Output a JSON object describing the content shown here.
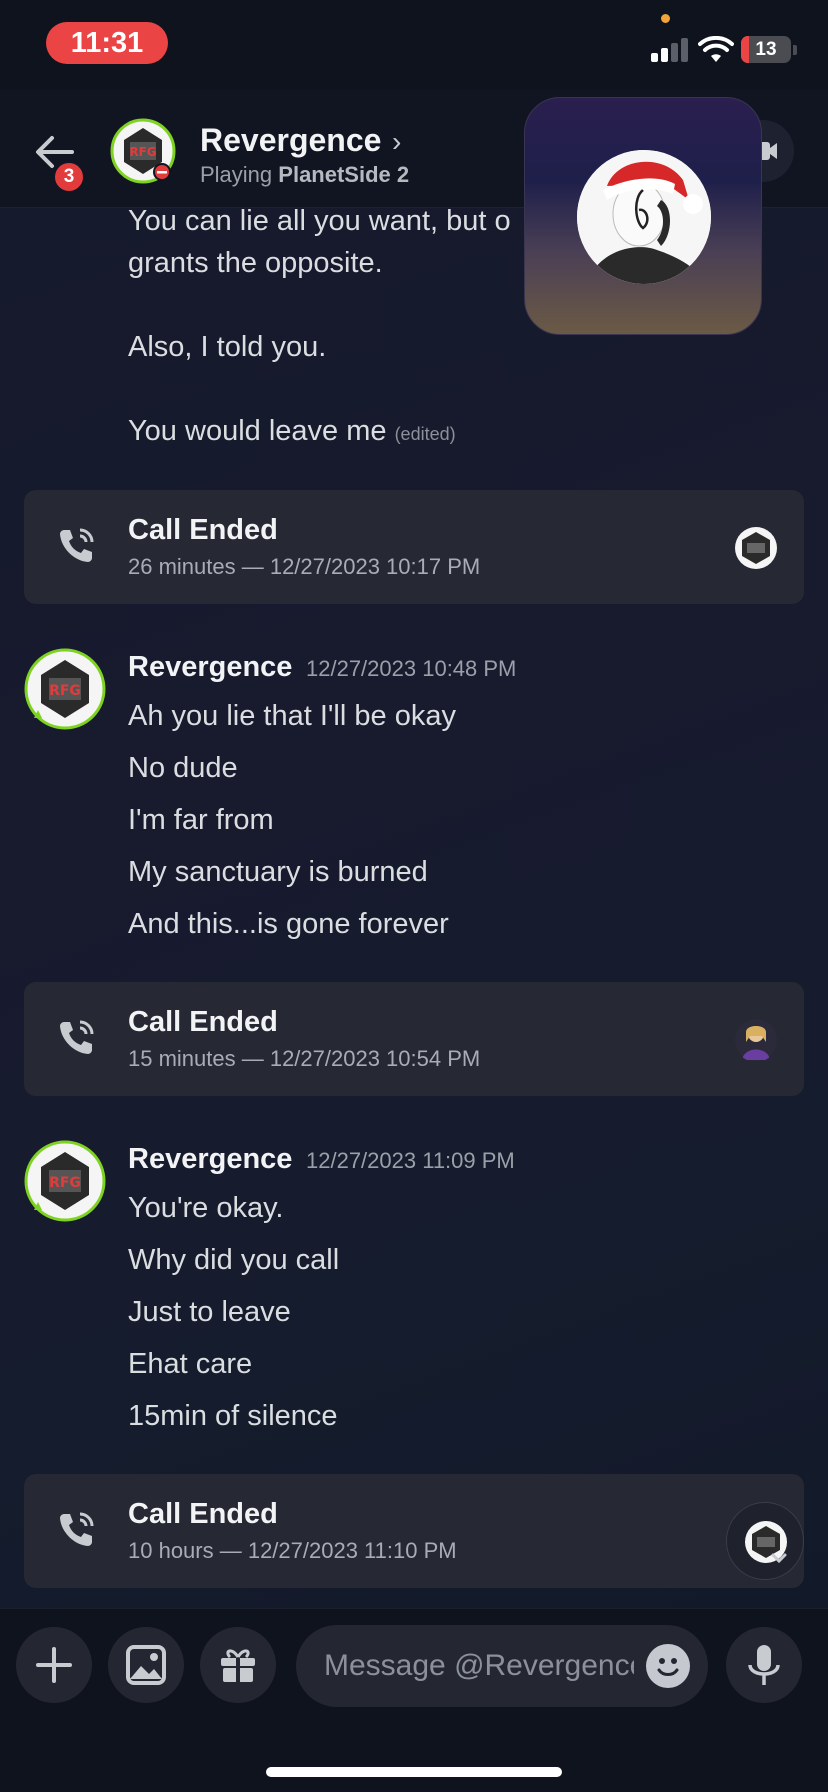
{
  "status_bar": {
    "time": "11:31",
    "battery": "13"
  },
  "header": {
    "back_badge": "3",
    "name": "Revergence",
    "status_prefix": "Playing",
    "status_game": "PlanetSide 2"
  },
  "messages_top": [
    {
      "text": "You can lie all you want, but o"
    },
    {
      "text": "grants the opposite."
    },
    {
      "text": "Also, I told you."
    },
    {
      "text": "You would leave me",
      "edited": "(edited)"
    }
  ],
  "call_cards": [
    {
      "title": "Call Ended",
      "subtitle": "26 minutes — 12/27/2023 10:17 PM"
    },
    {
      "title": "Call Ended",
      "subtitle": "15 minutes — 12/27/2023 10:54 PM"
    },
    {
      "title": "Call Ended",
      "subtitle": "10 hours — 12/27/2023 11:10 PM"
    }
  ],
  "groups": [
    {
      "author": "Revergence",
      "timestamp": "12/27/2023 10:48 PM",
      "lines": [
        "Ah you lie that I'll be okay",
        "No dude",
        "I'm far from",
        "My sanctuary is burned",
        "And this...is gone forever"
      ]
    },
    {
      "author": "Revergence",
      "timestamp": "12/27/2023 11:09 PM",
      "lines": [
        "You're okay.",
        "Why did you call",
        "Just to leave",
        "Ehat care",
        "15min of silence"
      ]
    }
  ],
  "composer": {
    "placeholder": "Message @Revergence"
  },
  "icons": {
    "back": "arrow-left-icon",
    "chevron": "chevron-right-icon",
    "video": "video-camera-icon",
    "phone": "phone-call-icon",
    "plus": "plus-icon",
    "image": "image-icon",
    "gift": "gift-icon",
    "emoji": "emoji-icon",
    "mic": "microphone-icon"
  },
  "colors": {
    "badge_red": "#e23b3b",
    "time_pill": "#eb4444",
    "accent_green": "#7ed321"
  }
}
